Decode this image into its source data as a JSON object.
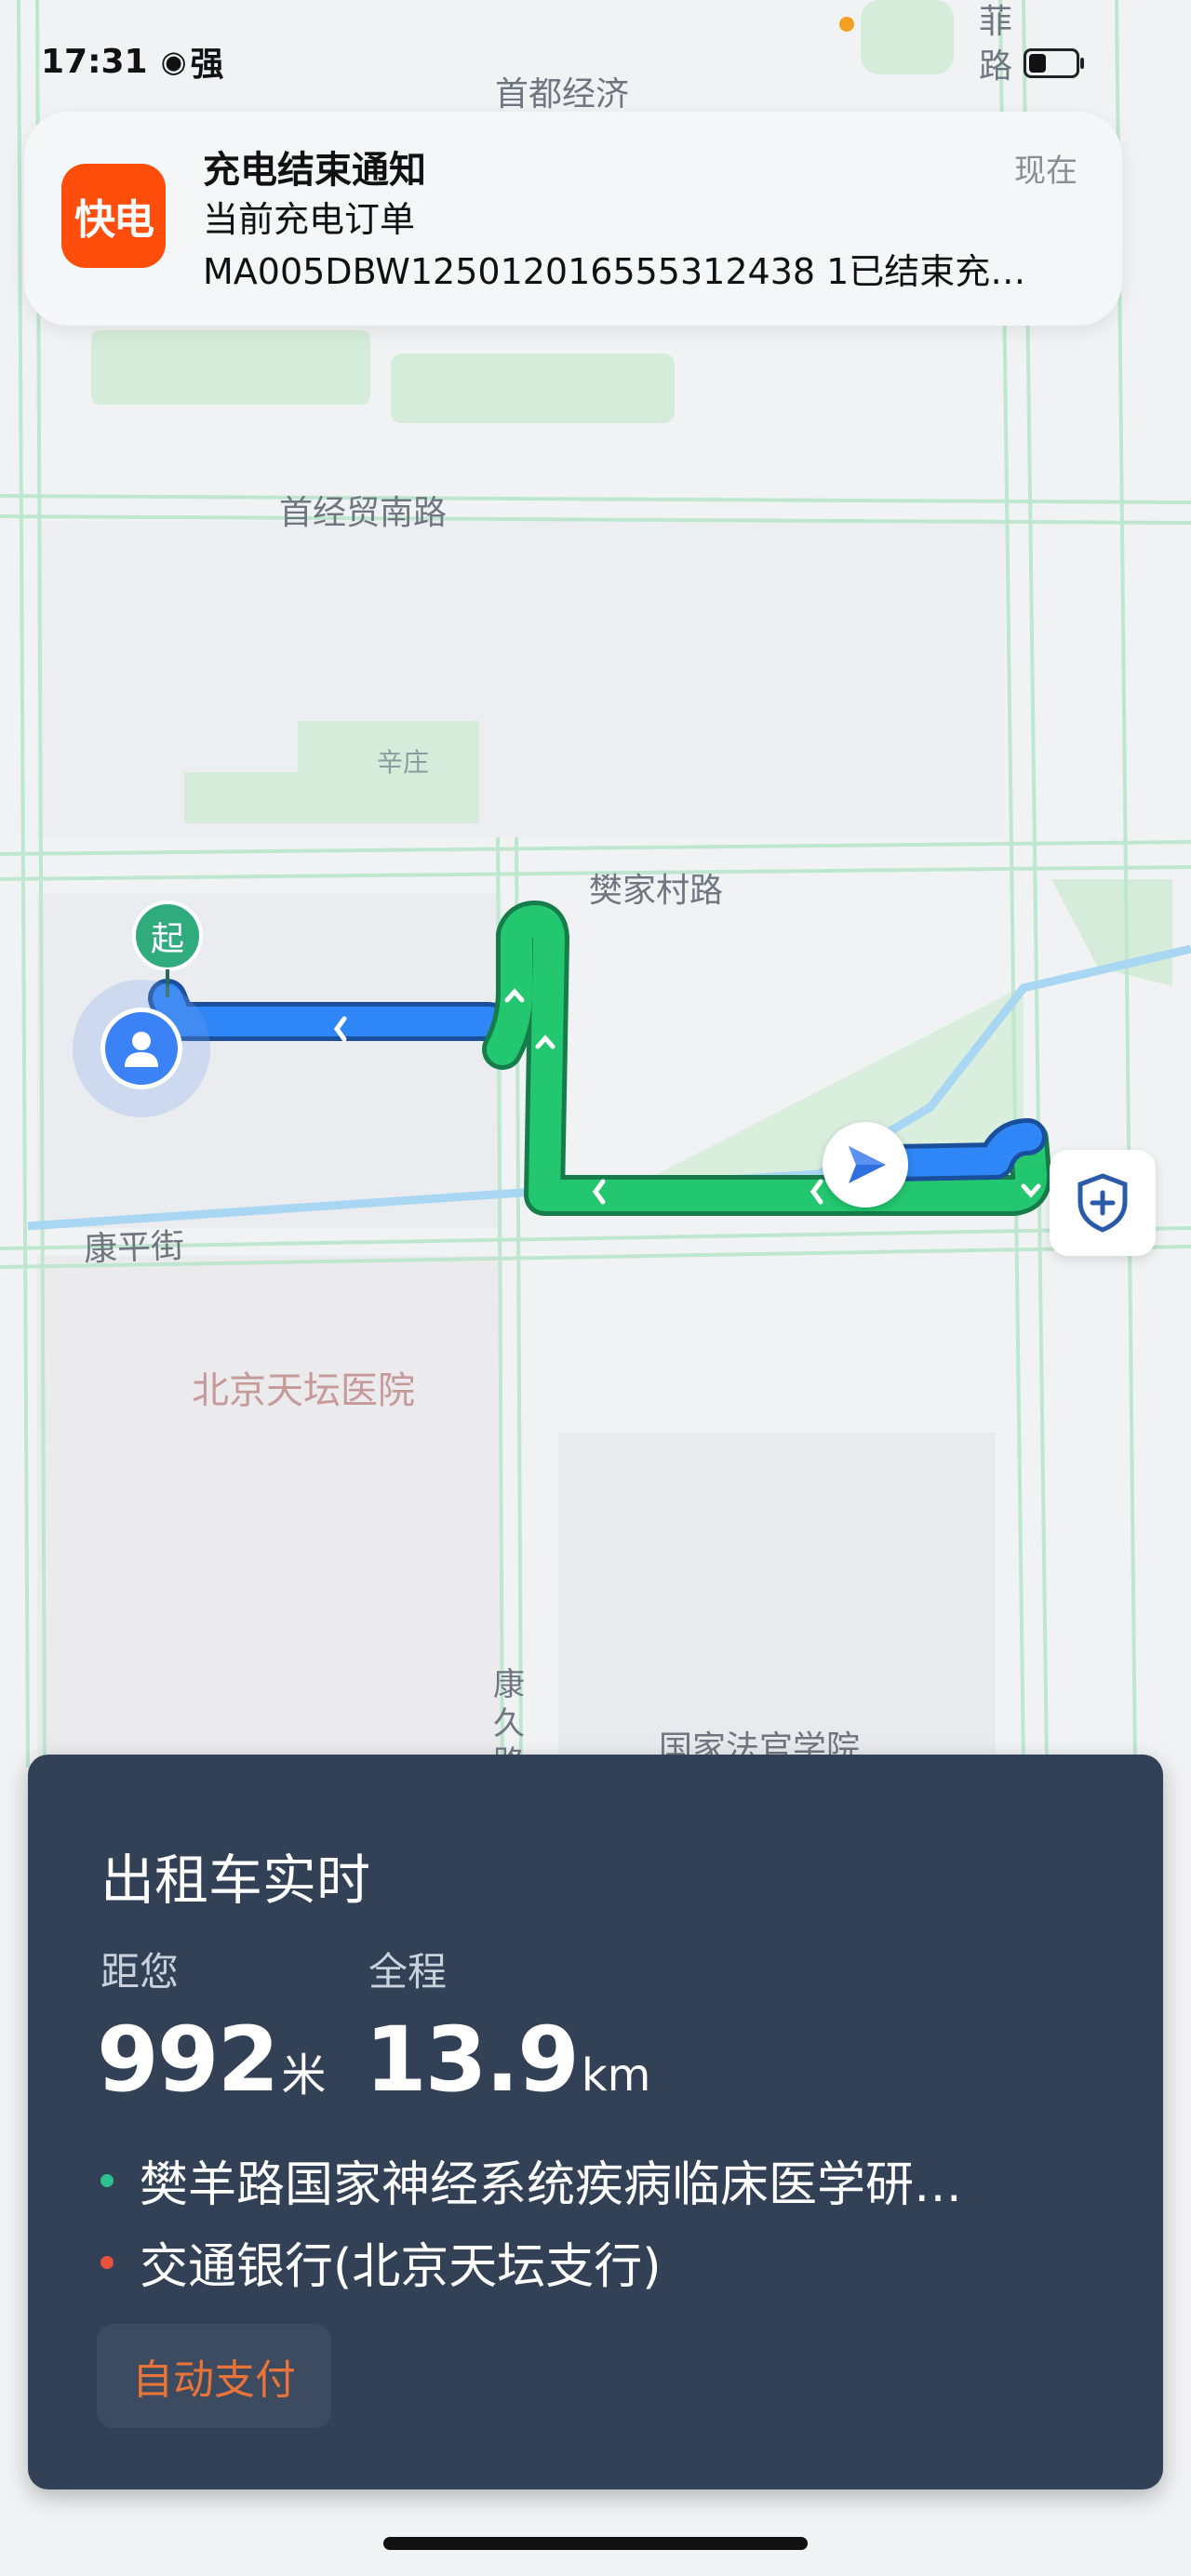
{
  "status_bar": {
    "time": "17:31",
    "signal": "强",
    "signal_icon": "carrier-signal-icon",
    "battery_level": 0.45
  },
  "notification": {
    "app_icon_text": "快电",
    "title": "充电结束通知",
    "time": "现在",
    "line1": "当前充电订单",
    "line2": "MA005DBW125012016555312438 1已结束充…"
  },
  "map_labels": {
    "road_top": "首都经济",
    "road_vertical_top": "菲路",
    "road_1": "首经贸南路",
    "village": "辛庄",
    "road_2": "樊家村路",
    "road_3": "康平街",
    "hospital": "北京天坛医院",
    "road_vertical": "康久路",
    "academy": "国家法官学院"
  },
  "markers": {
    "start_label": "起"
  },
  "panel": {
    "title": "出租车实时",
    "distance_label": "距您",
    "distance_value": "992",
    "distance_unit": "米",
    "total_label": "全程",
    "total_value": "13.9",
    "total_unit": "km",
    "from_address": "樊羊路国家神经系统疾病临床医学研…",
    "to_address": "交通银行(北京天坛支行)",
    "pay_button": "自动支付"
  },
  "colors": {
    "route_green": "#22c76f",
    "route_blue": "#2f86f6",
    "panel_bg": "#334156",
    "pay_text": "#e8743a",
    "start_dot": "#2fab7e",
    "end_dot": "#e5533c",
    "app_icon": "#ff4d0c"
  }
}
